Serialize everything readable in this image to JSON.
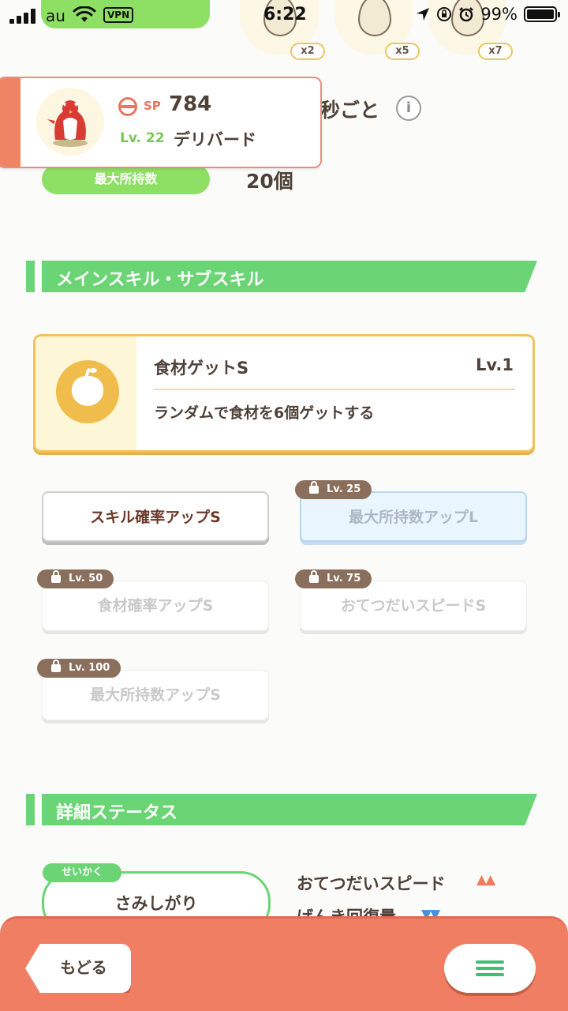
{
  "status_bar": {
    "carrier": "au",
    "vpn": "VPN",
    "time": "6:22",
    "battery": "99%",
    "battery_level": 0.99
  },
  "eggs": [
    {
      "mult": "x2"
    },
    {
      "mult": "x5"
    },
    {
      "mult": "x7"
    }
  ],
  "pokemon": {
    "sp_label": "SP",
    "sp_value": "784",
    "level": "Lv. 22",
    "name": "デリバード"
  },
  "behind": {
    "seconds_text": "秒ごと",
    "info": "i",
    "max_label": "最大所持数",
    "max_value": "20個"
  },
  "sections": {
    "skills": "メインスキル・サブスキル",
    "details": "詳細ステータス"
  },
  "main_skill": {
    "name": "食材ゲットS",
    "level": "Lv.1",
    "description": "ランダムで食材を6個ゲットする"
  },
  "sub_skills": [
    {
      "label": "スキル確率アップS",
      "lock": ""
    },
    {
      "label": "最大所持数アップL",
      "lock": "Lv. 25"
    },
    {
      "label": "食材確率アップS",
      "lock": "Lv. 50"
    },
    {
      "label": "おてつだいスピードS",
      "lock": "Lv. 75"
    },
    {
      "label": "最大所持数アップS",
      "lock": "Lv. 100"
    }
  ],
  "details": {
    "nature_tag": "せいかく",
    "nature": "さみしがり",
    "stat_up": "おてつだいスピード",
    "stat_down": "げんき回復量",
    "up_arrows": "▲▲",
    "down_arrows": "▼▼"
  },
  "bottom": {
    "back": "もどる"
  },
  "colors": {
    "accent_green": "#6bd474",
    "bottom_bar": "#f07e62",
    "gold": "#eec35d"
  }
}
